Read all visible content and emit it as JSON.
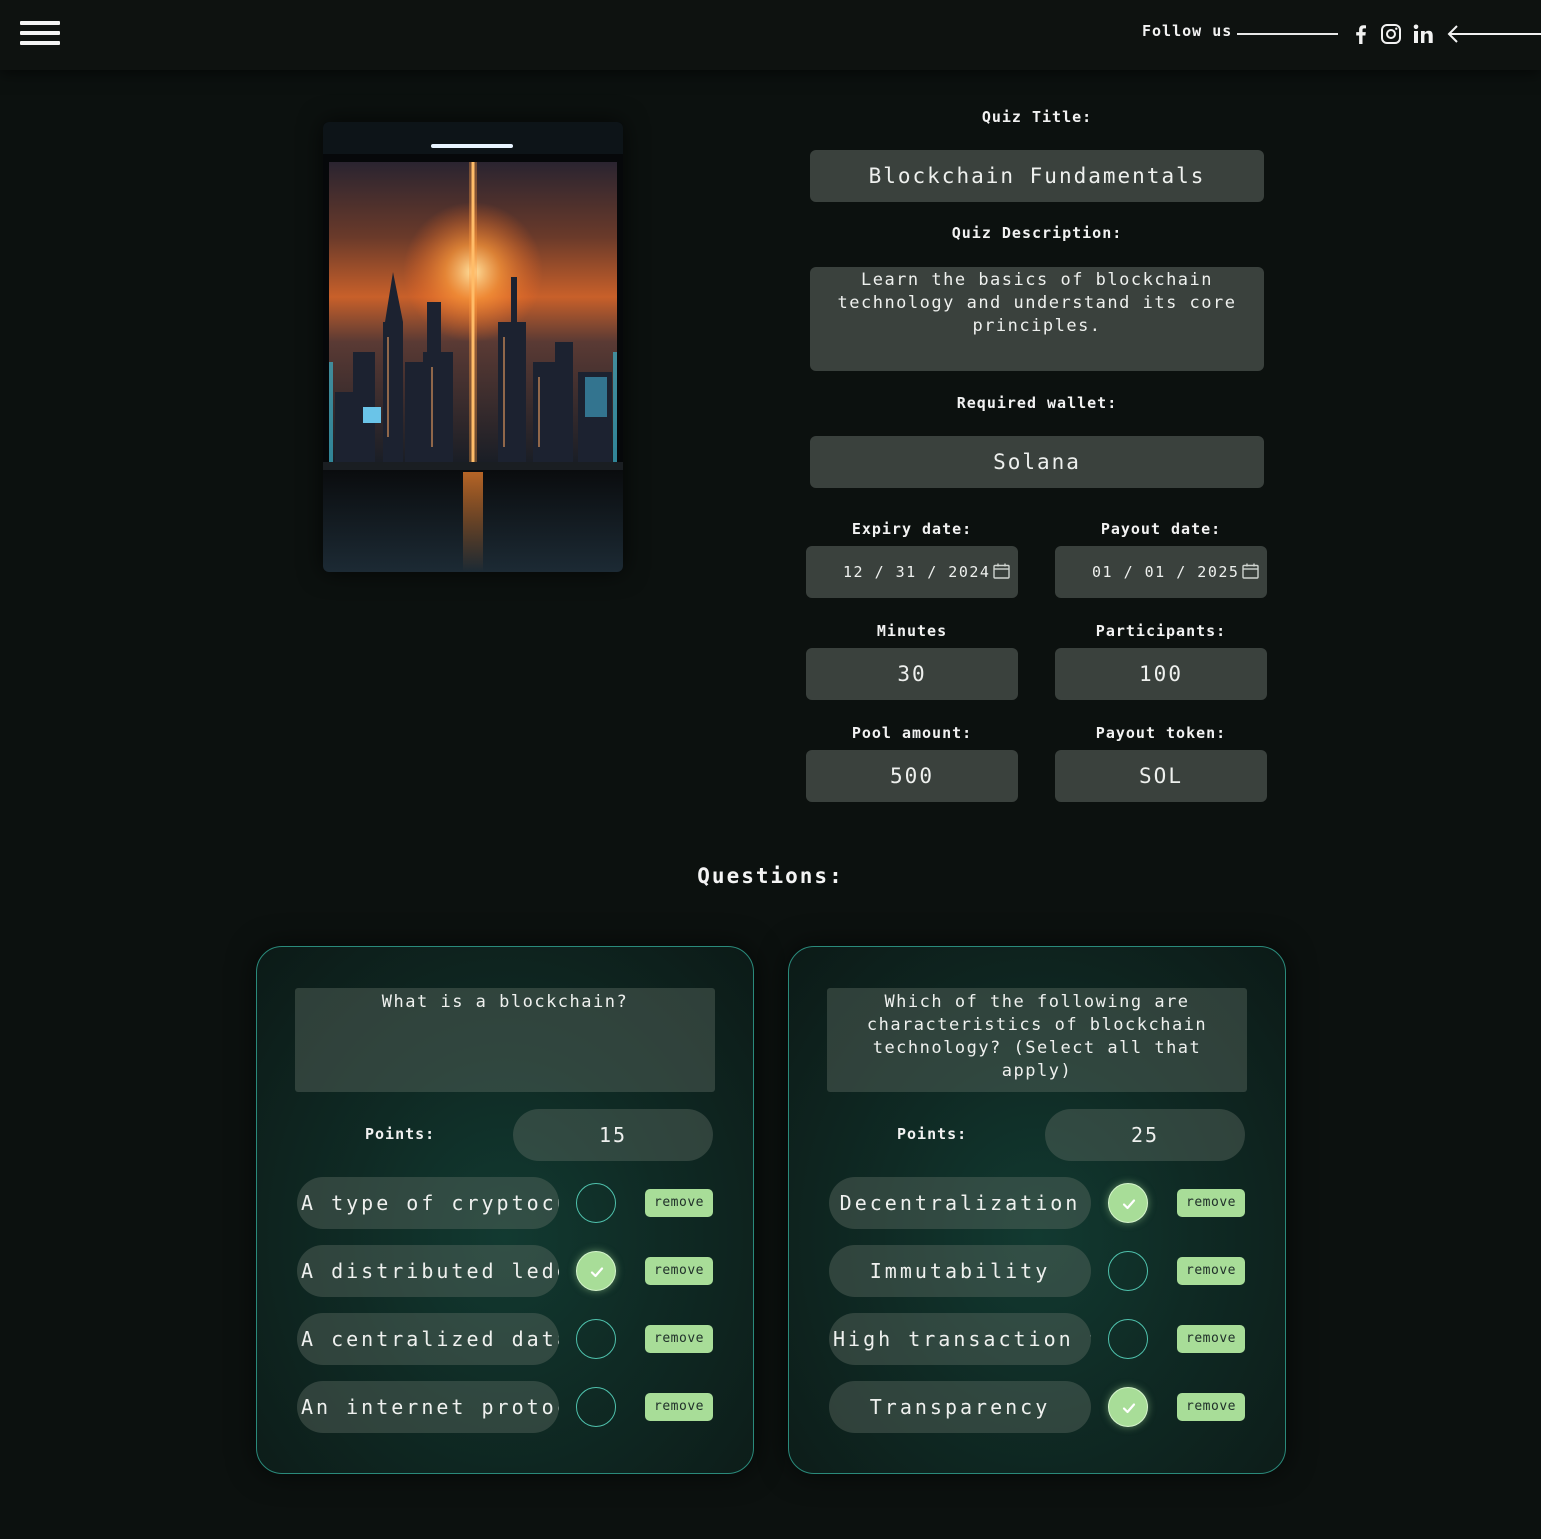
{
  "header": {
    "follow_label": "Follow us",
    "socials": [
      {
        "icon": "facebook-icon"
      },
      {
        "icon": "instagram-icon"
      },
      {
        "icon": "linkedin-icon"
      }
    ]
  },
  "form": {
    "quiz_title_label": "Quiz Title:",
    "quiz_title_value": "Blockchain Fundamentals",
    "quiz_description_label": "Quiz Description:",
    "quiz_description_value": "Learn the basics of blockchain technology and understand its core principles.",
    "required_wallet_label": "Required wallet:",
    "required_wallet_value": "Solana",
    "expiry_date_label": "Expiry date:",
    "expiry_date_value": "12 / 31 / 2024",
    "payout_date_label": "Payout date:",
    "payout_date_value": "01 / 01 / 2025",
    "minutes_label": "Minutes",
    "minutes_value": "30",
    "participants_label": "Participants:",
    "participants_value": "100",
    "pool_amount_label": "Pool amount:",
    "pool_amount_value": "500",
    "payout_token_label": "Payout token:",
    "payout_token_value": "SOL"
  },
  "questions_title": "Questions:",
  "questions": [
    {
      "text": "What is a blockchain?",
      "points_label": "Points:",
      "points": "15",
      "answers": [
        {
          "text": "A type of cryptocurrency",
          "correct": false,
          "remove_label": "remove"
        },
        {
          "text": "A distributed ledger",
          "correct": true,
          "remove_label": "remove"
        },
        {
          "text": "A centralized database",
          "correct": false,
          "remove_label": "remove"
        },
        {
          "text": "An internet protocol",
          "correct": false,
          "remove_label": "remove"
        }
      ]
    },
    {
      "text": "Which of the following are characteristics of blockchain technology? (Select all that apply)",
      "points_label": "Points:",
      "points": "25",
      "answers": [
        {
          "text": "Decentralization",
          "correct": true,
          "remove_label": "remove"
        },
        {
          "text": "Immutability",
          "correct": false,
          "remove_label": "remove"
        },
        {
          "text": "High transaction fees",
          "correct": false,
          "remove_label": "remove"
        },
        {
          "text": "Transparency",
          "correct": true,
          "remove_label": "remove"
        }
      ]
    }
  ],
  "colors": {
    "background": "#0c110f",
    "field": "#3a413d",
    "accent_green": "#a8dd98",
    "card_border": "#2a8a7b"
  }
}
